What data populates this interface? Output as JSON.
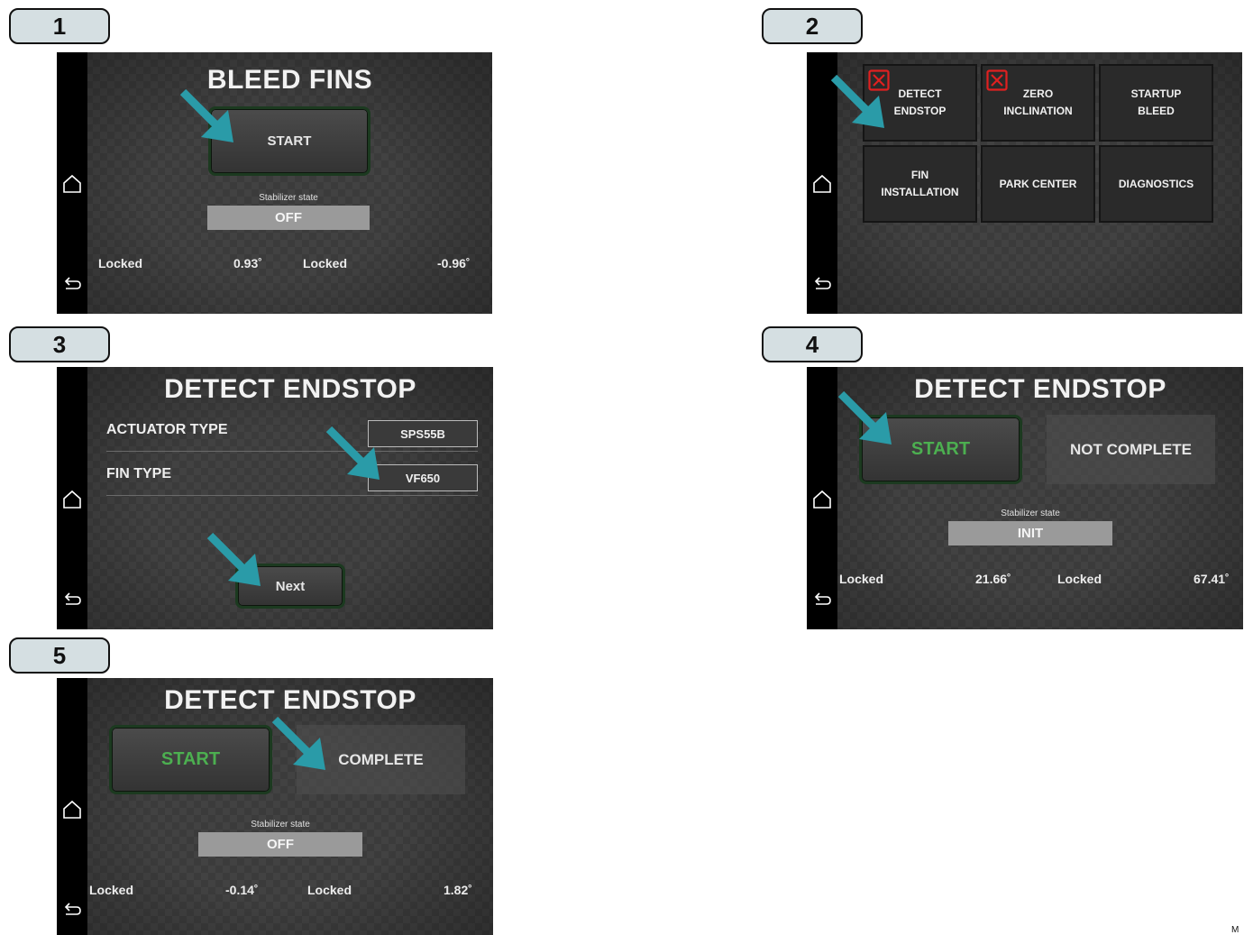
{
  "steps": [
    "1",
    "2",
    "3",
    "4",
    "5"
  ],
  "colors": {
    "tag_background": "#d5dfe2",
    "screen_background": "#3b3b3b",
    "start_green": "#4caf50",
    "arrow_teal": "#2a9ba8",
    "error_red": "#e02020"
  },
  "icons": {
    "home": "house-outline-icon",
    "back": "back-arrow-icon",
    "error": "red-x-box-icon",
    "pointer": "teal-arrow-icon"
  },
  "screen1": {
    "title": "BLEED FINS",
    "start_label": "START",
    "state_label": "Stabilizer state",
    "state_value": "OFF",
    "readouts": {
      "left_status": "Locked",
      "left_value": "0.93˚",
      "right_status": "Locked",
      "right_value": "-0.96˚"
    }
  },
  "screen2": {
    "tiles": [
      {
        "line1": "DETECT",
        "line2": "ENDSTOP",
        "error": true
      },
      {
        "line1": "ZERO",
        "line2": "INCLINATION",
        "error": true
      },
      {
        "line1": "STARTUP",
        "line2": "BLEED",
        "error": false
      },
      {
        "line1": "FIN",
        "line2": "INSTALLATION",
        "error": false
      },
      {
        "line1": "PARK CENTER",
        "line2": "",
        "error": false
      },
      {
        "line1": "DIAGNOSTICS",
        "line2": "",
        "error": false
      }
    ]
  },
  "screen3": {
    "title": "DETECT ENDSTOP",
    "actuator_label": "ACTUATOR TYPE",
    "actuator_value": "SPS55B",
    "fin_label": "FIN TYPE",
    "fin_value": "VF650",
    "next_label": "Next"
  },
  "screen4": {
    "title": "DETECT ENDSTOP",
    "start_label": "START",
    "status": "NOT COMPLETE",
    "state_label": "Stabilizer state",
    "state_value": "INIT",
    "readouts": {
      "left_status": "Locked",
      "left_value": "21.66˚",
      "right_status": "Locked",
      "right_value": "67.41˚"
    }
  },
  "screen5": {
    "title": "DETECT ENDSTOP",
    "start_label": "START",
    "status": "COMPLETE",
    "state_label": "Stabilizer state",
    "state_value": "OFF",
    "readouts": {
      "left_status": "Locked",
      "left_value": "-0.14˚",
      "right_status": "Locked",
      "right_value": "1.82˚"
    }
  },
  "footer_code": "M"
}
